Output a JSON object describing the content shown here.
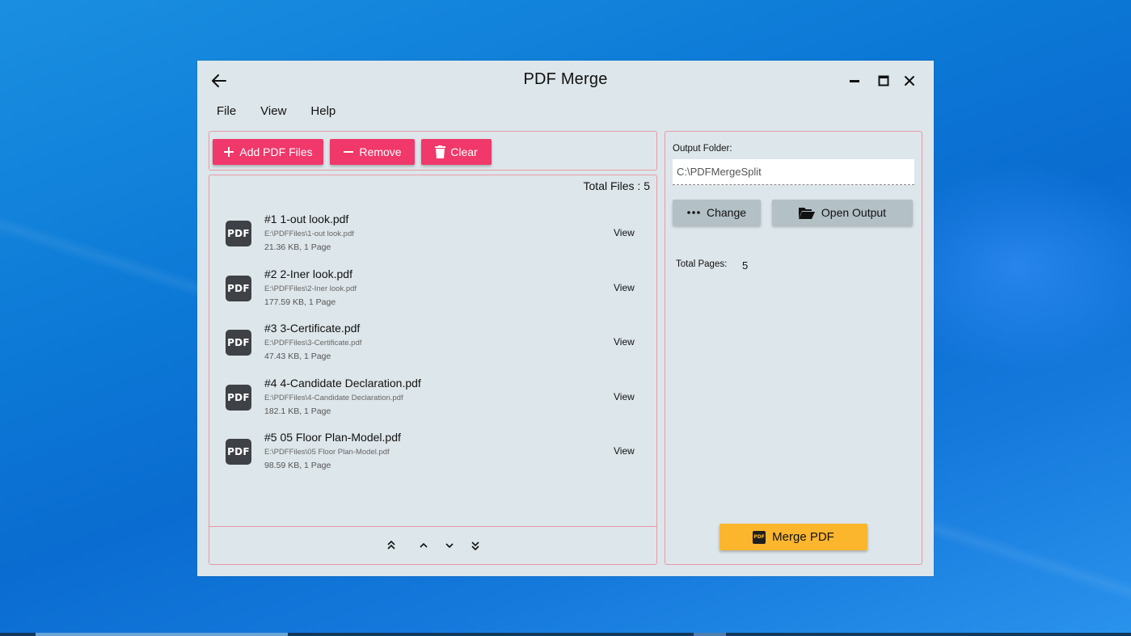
{
  "window": {
    "title": "PDF Merge"
  },
  "menu": [
    "File",
    "View",
    "Help"
  ],
  "toolbar": {
    "add_label": "Add PDF Files",
    "remove_label": "Remove",
    "clear_label": "Clear"
  },
  "list": {
    "total_files_label": "Total Files : 5",
    "view_label": "View",
    "pdf_icon_text": "PDF",
    "files": [
      {
        "name": "#1 1-out look.pdf",
        "path": "E:\\PDFFiles\\1-out look.pdf",
        "info": "21.36 KB, 1 Page"
      },
      {
        "name": "#2 2-Iner look.pdf",
        "path": "E:\\PDFFiles\\2-Iner look.pdf",
        "info": "177.59 KB, 1 Page"
      },
      {
        "name": "#3 3-Certificate.pdf",
        "path": "E:\\PDFFiles\\3-Certificate.pdf",
        "info": "47.43 KB, 1 Page"
      },
      {
        "name": "#4 4-Candidate Declaration.pdf",
        "path": "E:\\PDFFiles\\4-Candidate Declaration.pdf",
        "info": "182.1 KB, 1 Page"
      },
      {
        "name": "#5 05 Floor Plan-Model.pdf",
        "path": "E:\\PDFFiles\\05 Floor Plan-Model.pdf",
        "info": "98.59 KB, 1 Page"
      }
    ]
  },
  "output": {
    "label": "Output Folder:",
    "path": "C:\\PDFMergeSplit",
    "change_label": "Change",
    "open_label": "Open Output",
    "total_pages_label": "Total Pages:",
    "total_pages_value": "5"
  },
  "merge": {
    "label": "Merge PDF",
    "icon_text": "PDF"
  },
  "colors": {
    "accent_pink": "#f0386b",
    "merge_yellow": "#fbb62e",
    "panel_border": "#e79aa5",
    "window_bg": "#dde6ea"
  },
  "icons": {
    "back": "arrow-left-icon",
    "minimize": "minimize-icon",
    "maximize": "maximize-icon",
    "close": "close-icon",
    "add": "plus-icon",
    "remove": "minus-icon",
    "clear": "trash-icon",
    "change": "more-dots-icon",
    "open": "folder-open-icon",
    "move_top": "chevron-double-up-icon",
    "move_up": "chevron-up-icon",
    "move_down": "chevron-down-icon",
    "move_bottom": "chevron-double-down-icon"
  }
}
